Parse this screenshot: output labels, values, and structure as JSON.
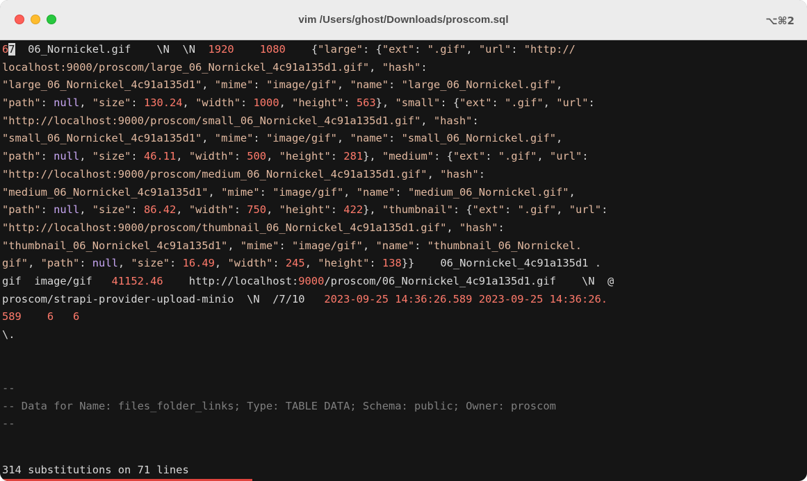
{
  "window": {
    "title": "vim /Users/ghost/Downloads/proscom.sql",
    "shortcut": "⌥⌘2"
  },
  "lines": [
    {
      "segments": [
        {
          "t": "6",
          "c": "num"
        },
        {
          "t": "7",
          "c": "cursor"
        },
        {
          "t": "  06_Nornickel.gif    \\N  \\N  ",
          "c": "txt"
        },
        {
          "t": "1920",
          "c": "num"
        },
        {
          "t": "    ",
          "c": "txt"
        },
        {
          "t": "1080",
          "c": "num"
        },
        {
          "t": "    {",
          "c": "txt"
        },
        {
          "t": "\"large\"",
          "c": "str"
        },
        {
          "t": ": {",
          "c": "txt"
        },
        {
          "t": "\"ext\"",
          "c": "str"
        },
        {
          "t": ": ",
          "c": "txt"
        },
        {
          "t": "\".gif\"",
          "c": "str"
        },
        {
          "t": ", ",
          "c": "txt"
        },
        {
          "t": "\"url\"",
          "c": "str"
        },
        {
          "t": ": ",
          "c": "txt"
        },
        {
          "t": "\"http://",
          "c": "str"
        }
      ]
    },
    {
      "segments": [
        {
          "t": "localhost:9000/proscom/large_06_Nornickel_4c91a135d1.gif\"",
          "c": "str"
        },
        {
          "t": ", ",
          "c": "txt"
        },
        {
          "t": "\"hash\"",
          "c": "str"
        },
        {
          "t": ":",
          "c": "txt"
        }
      ]
    },
    {
      "segments": [
        {
          "t": "\"large_06_Nornickel_4c91a135d1\"",
          "c": "str"
        },
        {
          "t": ", ",
          "c": "txt"
        },
        {
          "t": "\"mime\"",
          "c": "str"
        },
        {
          "t": ": ",
          "c": "txt"
        },
        {
          "t": "\"image/gif\"",
          "c": "str"
        },
        {
          "t": ", ",
          "c": "txt"
        },
        {
          "t": "\"name\"",
          "c": "str"
        },
        {
          "t": ": ",
          "c": "txt"
        },
        {
          "t": "\"large_06_Nornickel.gif\"",
          "c": "str"
        },
        {
          "t": ",",
          "c": "txt"
        }
      ]
    },
    {
      "segments": [
        {
          "t": "\"path\"",
          "c": "str"
        },
        {
          "t": ": ",
          "c": "txt"
        },
        {
          "t": "null",
          "c": "null"
        },
        {
          "t": ", ",
          "c": "txt"
        },
        {
          "t": "\"size\"",
          "c": "str"
        },
        {
          "t": ": ",
          "c": "txt"
        },
        {
          "t": "130.24",
          "c": "num"
        },
        {
          "t": ", ",
          "c": "txt"
        },
        {
          "t": "\"width\"",
          "c": "str"
        },
        {
          "t": ": ",
          "c": "txt"
        },
        {
          "t": "1000",
          "c": "num"
        },
        {
          "t": ", ",
          "c": "txt"
        },
        {
          "t": "\"height\"",
          "c": "str"
        },
        {
          "t": ": ",
          "c": "txt"
        },
        {
          "t": "563",
          "c": "num"
        },
        {
          "t": "}, ",
          "c": "txt"
        },
        {
          "t": "\"small\"",
          "c": "str"
        },
        {
          "t": ": {",
          "c": "txt"
        },
        {
          "t": "\"ext\"",
          "c": "str"
        },
        {
          "t": ": ",
          "c": "txt"
        },
        {
          "t": "\".gif\"",
          "c": "str"
        },
        {
          "t": ", ",
          "c": "txt"
        },
        {
          "t": "\"url\"",
          "c": "str"
        },
        {
          "t": ":",
          "c": "txt"
        }
      ]
    },
    {
      "segments": [
        {
          "t": "\"http://localhost:9000/proscom/small_06_Nornickel_4c91a135d1.gif\"",
          "c": "str"
        },
        {
          "t": ", ",
          "c": "txt"
        },
        {
          "t": "\"hash\"",
          "c": "str"
        },
        {
          "t": ":",
          "c": "txt"
        }
      ]
    },
    {
      "segments": [
        {
          "t": "\"small_06_Nornickel_4c91a135d1\"",
          "c": "str"
        },
        {
          "t": ", ",
          "c": "txt"
        },
        {
          "t": "\"mime\"",
          "c": "str"
        },
        {
          "t": ": ",
          "c": "txt"
        },
        {
          "t": "\"image/gif\"",
          "c": "str"
        },
        {
          "t": ", ",
          "c": "txt"
        },
        {
          "t": "\"name\"",
          "c": "str"
        },
        {
          "t": ": ",
          "c": "txt"
        },
        {
          "t": "\"small_06_Nornickel.gif\"",
          "c": "str"
        },
        {
          "t": ",",
          "c": "txt"
        }
      ]
    },
    {
      "segments": [
        {
          "t": "\"path\"",
          "c": "str"
        },
        {
          "t": ": ",
          "c": "txt"
        },
        {
          "t": "null",
          "c": "null"
        },
        {
          "t": ", ",
          "c": "txt"
        },
        {
          "t": "\"size\"",
          "c": "str"
        },
        {
          "t": ": ",
          "c": "txt"
        },
        {
          "t": "46.11",
          "c": "num"
        },
        {
          "t": ", ",
          "c": "txt"
        },
        {
          "t": "\"width\"",
          "c": "str"
        },
        {
          "t": ": ",
          "c": "txt"
        },
        {
          "t": "500",
          "c": "num"
        },
        {
          "t": ", ",
          "c": "txt"
        },
        {
          "t": "\"height\"",
          "c": "str"
        },
        {
          "t": ": ",
          "c": "txt"
        },
        {
          "t": "281",
          "c": "num"
        },
        {
          "t": "}, ",
          "c": "txt"
        },
        {
          "t": "\"medium\"",
          "c": "str"
        },
        {
          "t": ": {",
          "c": "txt"
        },
        {
          "t": "\"ext\"",
          "c": "str"
        },
        {
          "t": ": ",
          "c": "txt"
        },
        {
          "t": "\".gif\"",
          "c": "str"
        },
        {
          "t": ", ",
          "c": "txt"
        },
        {
          "t": "\"url\"",
          "c": "str"
        },
        {
          "t": ":",
          "c": "txt"
        }
      ]
    },
    {
      "segments": [
        {
          "t": "\"http://localhost:9000/proscom/medium_06_Nornickel_4c91a135d1.gif\"",
          "c": "str"
        },
        {
          "t": ", ",
          "c": "txt"
        },
        {
          "t": "\"hash\"",
          "c": "str"
        },
        {
          "t": ":",
          "c": "txt"
        }
      ]
    },
    {
      "segments": [
        {
          "t": "\"medium_06_Nornickel_4c91a135d1\"",
          "c": "str"
        },
        {
          "t": ", ",
          "c": "txt"
        },
        {
          "t": "\"mime\"",
          "c": "str"
        },
        {
          "t": ": ",
          "c": "txt"
        },
        {
          "t": "\"image/gif\"",
          "c": "str"
        },
        {
          "t": ", ",
          "c": "txt"
        },
        {
          "t": "\"name\"",
          "c": "str"
        },
        {
          "t": ": ",
          "c": "txt"
        },
        {
          "t": "\"medium_06_Nornickel.gif\"",
          "c": "str"
        },
        {
          "t": ",",
          "c": "txt"
        }
      ]
    },
    {
      "segments": [
        {
          "t": "\"path\"",
          "c": "str"
        },
        {
          "t": ": ",
          "c": "txt"
        },
        {
          "t": "null",
          "c": "null"
        },
        {
          "t": ", ",
          "c": "txt"
        },
        {
          "t": "\"size\"",
          "c": "str"
        },
        {
          "t": ": ",
          "c": "txt"
        },
        {
          "t": "86.42",
          "c": "num"
        },
        {
          "t": ", ",
          "c": "txt"
        },
        {
          "t": "\"width\"",
          "c": "str"
        },
        {
          "t": ": ",
          "c": "txt"
        },
        {
          "t": "750",
          "c": "num"
        },
        {
          "t": ", ",
          "c": "txt"
        },
        {
          "t": "\"height\"",
          "c": "str"
        },
        {
          "t": ": ",
          "c": "txt"
        },
        {
          "t": "422",
          "c": "num"
        },
        {
          "t": "}, ",
          "c": "txt"
        },
        {
          "t": "\"thumbnail\"",
          "c": "str"
        },
        {
          "t": ": {",
          "c": "txt"
        },
        {
          "t": "\"ext\"",
          "c": "str"
        },
        {
          "t": ": ",
          "c": "txt"
        },
        {
          "t": "\".gif\"",
          "c": "str"
        },
        {
          "t": ", ",
          "c": "txt"
        },
        {
          "t": "\"url\"",
          "c": "str"
        },
        {
          "t": ":",
          "c": "txt"
        }
      ]
    },
    {
      "segments": [
        {
          "t": "\"http://localhost:9000/proscom/thumbnail_06_Nornickel_4c91a135d1.gif\"",
          "c": "str"
        },
        {
          "t": ", ",
          "c": "txt"
        },
        {
          "t": "\"hash\"",
          "c": "str"
        },
        {
          "t": ":",
          "c": "txt"
        }
      ]
    },
    {
      "segments": [
        {
          "t": "\"thumbnail_06_Nornickel_4c91a135d1\"",
          "c": "str"
        },
        {
          "t": ", ",
          "c": "txt"
        },
        {
          "t": "\"mime\"",
          "c": "str"
        },
        {
          "t": ": ",
          "c": "txt"
        },
        {
          "t": "\"image/gif\"",
          "c": "str"
        },
        {
          "t": ", ",
          "c": "txt"
        },
        {
          "t": "\"name\"",
          "c": "str"
        },
        {
          "t": ": ",
          "c": "txt"
        },
        {
          "t": "\"thumbnail_06_Nornickel.",
          "c": "str"
        }
      ]
    },
    {
      "segments": [
        {
          "t": "gif\"",
          "c": "str"
        },
        {
          "t": ", ",
          "c": "txt"
        },
        {
          "t": "\"path\"",
          "c": "str"
        },
        {
          "t": ": ",
          "c": "txt"
        },
        {
          "t": "null",
          "c": "null"
        },
        {
          "t": ", ",
          "c": "txt"
        },
        {
          "t": "\"size\"",
          "c": "str"
        },
        {
          "t": ": ",
          "c": "txt"
        },
        {
          "t": "16.49",
          "c": "num"
        },
        {
          "t": ", ",
          "c": "txt"
        },
        {
          "t": "\"width\"",
          "c": "str"
        },
        {
          "t": ": ",
          "c": "txt"
        },
        {
          "t": "245",
          "c": "num"
        },
        {
          "t": ", ",
          "c": "txt"
        },
        {
          "t": "\"height\"",
          "c": "str"
        },
        {
          "t": ": ",
          "c": "txt"
        },
        {
          "t": "138",
          "c": "num"
        },
        {
          "t": "}}    06_Nornickel_4c91a135d1 .",
          "c": "txt"
        }
      ]
    },
    {
      "segments": [
        {
          "t": "gif  image/gif   ",
          "c": "txt"
        },
        {
          "t": "41152.46",
          "c": "num"
        },
        {
          "t": "    http://localhost:",
          "c": "txt"
        },
        {
          "t": "9000",
          "c": "num"
        },
        {
          "t": "/proscom/06_Nornickel_4c91a135d1.gif    \\N  @",
          "c": "txt"
        }
      ]
    },
    {
      "segments": [
        {
          "t": "proscom/strapi-provider-upload-minio  \\N  /7/10   ",
          "c": "txt"
        },
        {
          "t": "2023-09-25 14:36:26.589 2023-09-25 14:36:26.",
          "c": "num"
        }
      ]
    },
    {
      "segments": [
        {
          "t": "589",
          "c": "num"
        },
        {
          "t": "    ",
          "c": "txt"
        },
        {
          "t": "6",
          "c": "num"
        },
        {
          "t": "   ",
          "c": "txt"
        },
        {
          "t": "6",
          "c": "num"
        }
      ]
    },
    {
      "segments": [
        {
          "t": "\\.",
          "c": "txt"
        }
      ]
    },
    {
      "segments": [
        {
          "t": "",
          "c": "txt"
        }
      ]
    },
    {
      "segments": [
        {
          "t": "",
          "c": "txt"
        }
      ]
    },
    {
      "segments": [
        {
          "t": "--",
          "c": "cmt"
        }
      ]
    },
    {
      "segments": [
        {
          "t": "-- Data for Name: files_folder_links; Type: TABLE DATA; Schema: public; Owner: proscom",
          "c": "cmt"
        }
      ]
    },
    {
      "segments": [
        {
          "t": "--",
          "c": "cmt"
        }
      ]
    }
  ],
  "status": {
    "message": "314 substitutions on 71 lines"
  }
}
